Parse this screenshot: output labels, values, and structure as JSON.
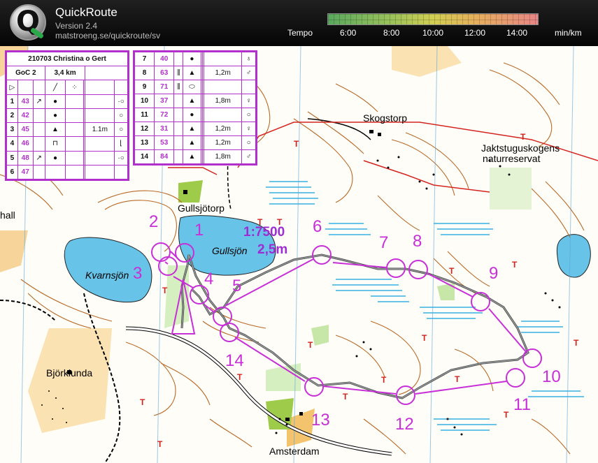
{
  "app": {
    "name": "QuickRoute",
    "version": "Version 2.4",
    "url": "matstroeng.se/quickroute/sv"
  },
  "tempo_legend": {
    "label": "Tempo",
    "unit": "min/km",
    "ticks": [
      "6:00",
      "8:00",
      "10:00",
      "12:00",
      "14:00"
    ],
    "colors": {
      "fast": "#59a85e",
      "mid": "#d2cf52",
      "slow": "#e98586"
    }
  },
  "map": {
    "scale_text": "1:7500",
    "contour_text": "2,5m",
    "place_names": {
      "skogstorp": "Skogstorp",
      "jaktstuga_1": "Jaktstuguskogens",
      "jaktstuga_2": "naturreservat",
      "gullsjotorp": "Gullsjötorp",
      "gullsjon": "Gullsjön",
      "kvarnsjon": "Kvarnsjön",
      "bjorklunda": "Björklunda",
      "amsterdam": "Amsterdam",
      "hall": "hall"
    },
    "controls": [
      "1",
      "2",
      "3",
      "4",
      "5",
      "6",
      "7",
      "8",
      "9",
      "10",
      "11",
      "12",
      "13",
      "14"
    ],
    "colors": {
      "course": "#c72fd7",
      "water": "#67c3e8",
      "contour": "#b96a27",
      "route": "#555555"
    }
  },
  "description": {
    "event": "210703 Christina o Gert",
    "class": "GoC 2",
    "length": "3,4 km",
    "left_rows": [
      {
        "n": "1",
        "code": "43",
        "dir": "↗",
        "feat": "●",
        "app": "",
        "dim": "",
        "loc": "·○"
      },
      {
        "n": "2",
        "code": "42",
        "dir": "",
        "feat": "●",
        "app": "",
        "dim": "",
        "loc": "○"
      },
      {
        "n": "3",
        "code": "45",
        "dir": "",
        "feat": "▲",
        "app": "",
        "dim": "1.1m",
        "loc": "○"
      },
      {
        "n": "4",
        "code": "46",
        "dir": "",
        "feat": "⊓",
        "app": "",
        "dim": "",
        "loc": "⌊"
      },
      {
        "n": "5",
        "code": "48",
        "dir": "↗",
        "feat": "●",
        "app": "",
        "dim": "",
        "loc": "·○"
      },
      {
        "n": "6",
        "code": "47",
        "dir": "",
        "feat": "",
        "app": "",
        "dim": "",
        "loc": ""
      }
    ],
    "right_rows": [
      {
        "n": "7",
        "code": "40",
        "dir": "",
        "feat": "●",
        "app": "",
        "dim": "",
        "loc": "♁"
      },
      {
        "n": "8",
        "code": "63",
        "dir": "⫼",
        "feat": "▲",
        "app": "",
        "dim": "1,2m",
        "loc": "♂"
      },
      {
        "n": "9",
        "code": "71",
        "dir": "⫼",
        "feat": "⬭",
        "app": "",
        "dim": "",
        "loc": ""
      },
      {
        "n": "10",
        "code": "37",
        "dir": "",
        "feat": "▲",
        "app": "",
        "dim": "1,8m",
        "loc": "♀"
      },
      {
        "n": "11",
        "code": "72",
        "dir": "",
        "feat": "●",
        "app": "",
        "dim": "",
        "loc": "○"
      },
      {
        "n": "12",
        "code": "31",
        "dir": "",
        "feat": "▲",
        "app": "",
        "dim": "1,2m",
        "loc": "♀"
      },
      {
        "n": "13",
        "code": "53",
        "dir": "",
        "feat": "▲",
        "app": "",
        "dim": "1,2m",
        "loc": "○"
      },
      {
        "n": "14",
        "code": "84",
        "dir": "",
        "feat": "▲",
        "app": "",
        "dim": "1,8m",
        "loc": "♂"
      }
    ]
  }
}
